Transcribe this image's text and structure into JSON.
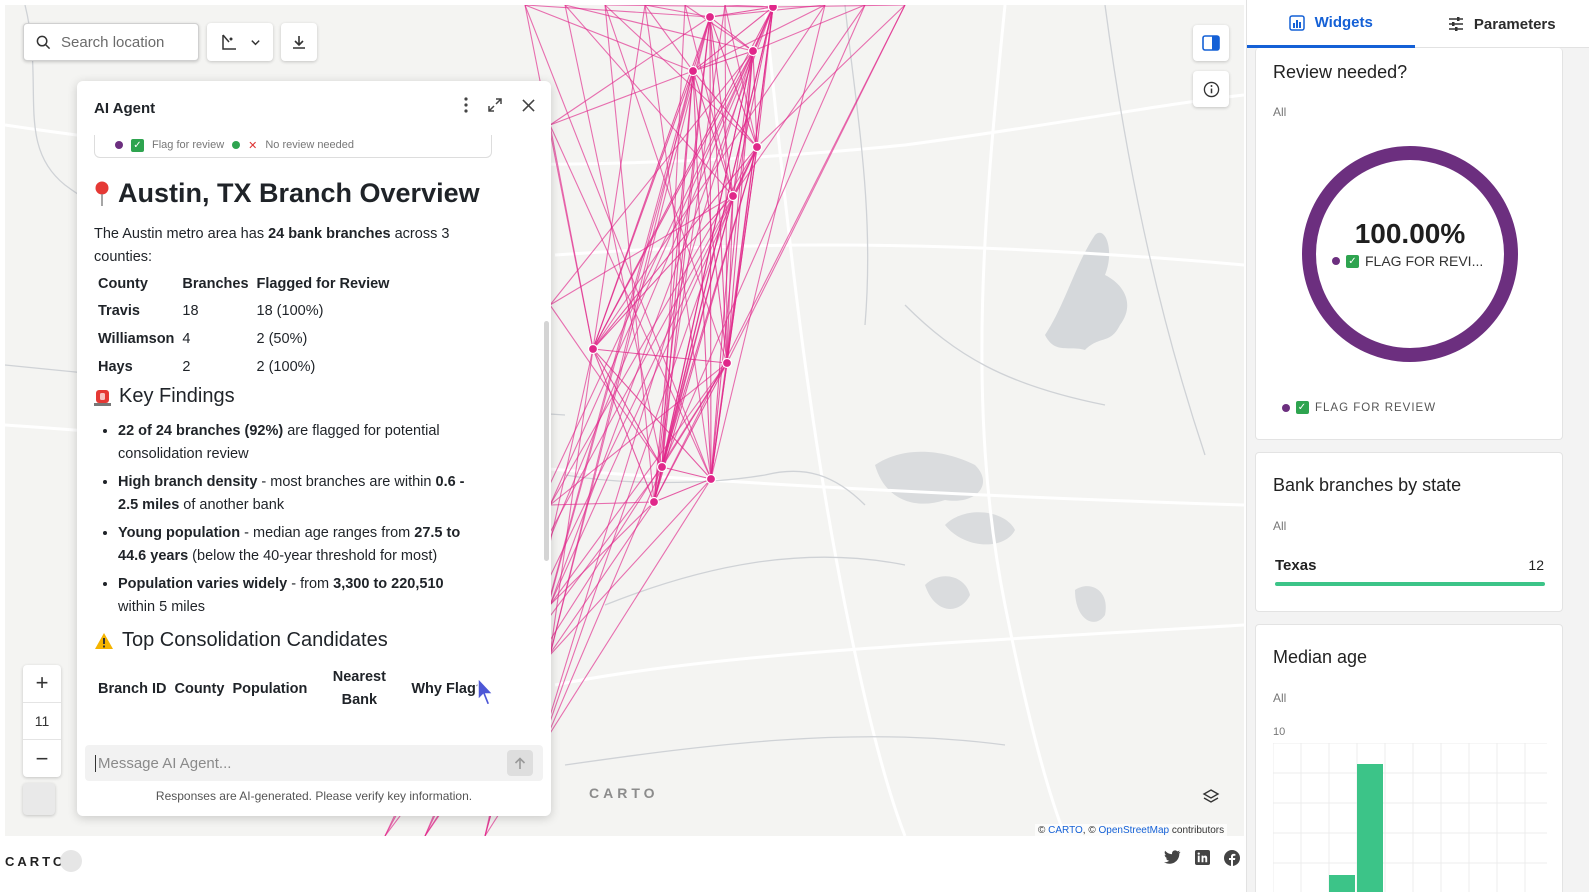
{
  "map": {
    "search_placeholder": "Search location",
    "zoom_level": "11",
    "zoom_in": "+",
    "zoom_out": "−",
    "watermark": "CARTO",
    "attribution": {
      "prefix": "© ",
      "carto": "CARTO",
      "sep": ", © ",
      "osm": "OpenStreetMap",
      "suffix": " contributors"
    },
    "line_color": "#e0278a"
  },
  "agent": {
    "title": "AI Agent",
    "prev_legend": [
      "Flag for review",
      "No review needed"
    ],
    "heading": "Austin, TX Branch Overview",
    "intro_pre": "The Austin metro area has ",
    "intro_bold": "24 bank branches",
    "intro_post": " across 3 counties:",
    "county_table": {
      "headers": [
        "County",
        "Branches",
        "Flagged for Review"
      ],
      "rows": [
        [
          "Travis",
          "18",
          "18 (100%)"
        ],
        [
          "Williamson",
          "4",
          "2 (50%)"
        ],
        [
          "Hays",
          "2",
          "2 (100%)"
        ]
      ]
    },
    "findings_heading": "Key Findings",
    "findings": [
      {
        "bold": "22 of 24 branches (92%)",
        "rest": " are flagged for potential consolidation review"
      },
      {
        "bold": "High branch density",
        "rest": " - most branches are within ",
        "bold2": "0.6 - 2.5 miles",
        "rest2": " of another bank"
      },
      {
        "bold": "Young population",
        "rest": " - median age ranges from ",
        "bold2": "27.5 to 44.6 years",
        "rest2": " (below the 40-year threshold for most)"
      },
      {
        "bold": "Population varies widely",
        "rest": " - from ",
        "bold2": "3,300 to 220,510",
        "rest2": " within 5 miles"
      }
    ],
    "candidates_heading": "Top Consolidation Candidates",
    "candidates_headers": [
      "Branch ID",
      "County",
      "Population",
      "Nearest Bank",
      "Why Flag?"
    ],
    "input_placeholder": "Message AI Agent...",
    "disclaimer": "Responses are AI-generated. Please verify key information."
  },
  "footer": {
    "logo": "CARTO"
  },
  "right_panel": {
    "tabs": [
      {
        "label": "Widgets",
        "active": true
      },
      {
        "label": "Parameters",
        "active": false
      }
    ],
    "review": {
      "title": "Review needed?",
      "filter": "All",
      "percent": "100.00%",
      "center_label": "FLAG FOR REVI...",
      "legend": "FLAG FOR REVIEW",
      "color": "#6c2f7f"
    },
    "state": {
      "title": "Bank branches by state",
      "filter": "All",
      "label": "Texas",
      "value": "12",
      "color": "#3cc488"
    },
    "age": {
      "title": "Median age",
      "filter": "All",
      "y_tick": "10",
      "color": "#3cc488"
    }
  }
}
